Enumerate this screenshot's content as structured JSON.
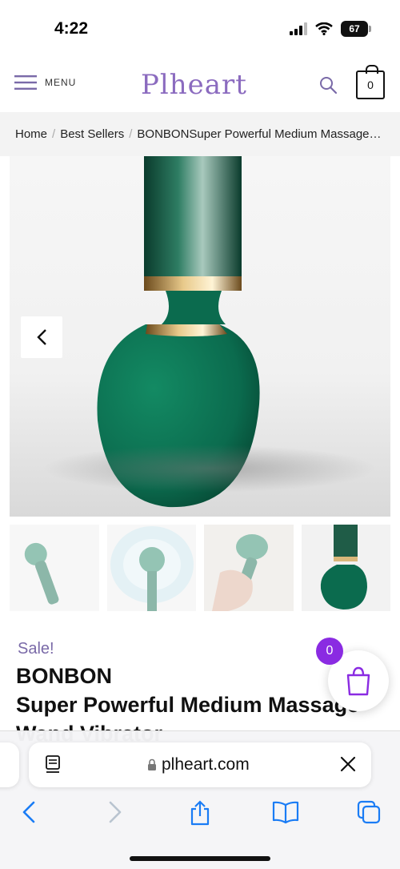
{
  "status": {
    "time": "4:22",
    "battery": "67"
  },
  "header": {
    "menu_label": "MENU",
    "logo": "Plheart",
    "cart_count": "0"
  },
  "breadcrumb": {
    "items": [
      "Home",
      "Best Sellers",
      "BONBONSuper Powerful Medium Massage Wand Vibrator"
    ]
  },
  "product": {
    "sale_label": "Sale!",
    "title_line1": "BONBON",
    "title_line2": "Super Powerful Medium Massage",
    "title_line3": "Wand Vibrator",
    "bag_count": "0"
  },
  "browser": {
    "url": "plheart.com"
  },
  "colors": {
    "brand_purple": "#8b6bbf",
    "badge_purple": "#8a2be2",
    "product_green": "#0b6b4e",
    "ios_blue": "#1a7cf5"
  },
  "icons": [
    "hamburger-icon",
    "search-icon",
    "cart-icon",
    "chevron-left-icon",
    "bag-icon",
    "lock-icon",
    "reader-icon",
    "close-icon",
    "back-icon",
    "forward-icon",
    "share-icon",
    "bookmarks-icon",
    "tabs-icon"
  ]
}
